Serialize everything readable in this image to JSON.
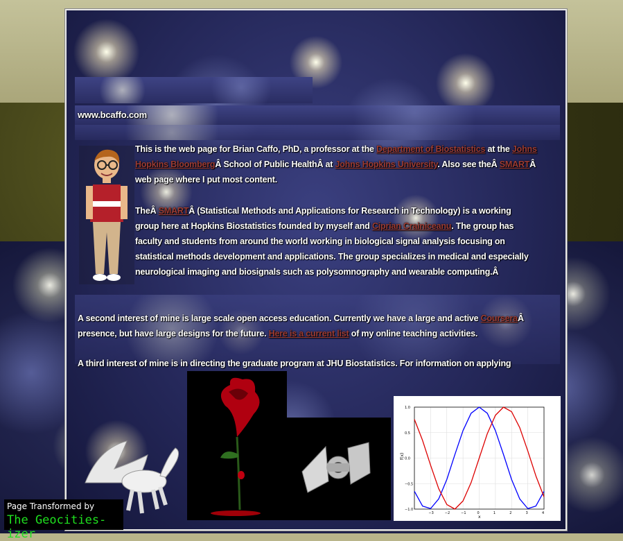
{
  "site": {
    "url_label": "www.bcaffo.com"
  },
  "para1": {
    "t1": "This is the web page for Brian Caffo, PhD, a professor at the ",
    "link_dept": "Department of Biostatistics",
    "t2": " at the ",
    "link_jh_bloomberg": "Johns Hopkins Bloomberg",
    "t3": "Â School of Public HealthÂ at ",
    "link_jhu": "Johns Hopkins University",
    "t4": ". Also see theÂ ",
    "link_smart": "SMART",
    "t5": "Â web page where I put most content."
  },
  "para2": {
    "t1": "TheÂ ",
    "link_smart": "SMART",
    "t2": "Â (Statistical Methods and Applications for Research in Technology) is a working group here at Hopkins Biostatistics founded by myself and ",
    "link_ciprian": "Ciprian Crainiceanu",
    "t3": ". The group has faculty and students from around the world working in biological signal analysis focusing on statistical methods development and applications. The group specializes in medical and especially neurological imaging and biosignals such as polysomnography and wearable computing.Â"
  },
  "para3": {
    "t1": "A second interest of mine is large scale open access education. Currently we have a large and active ",
    "link_coursera": "Coursera",
    "t2": "Â presence, but have large designs for the future. ",
    "link_current_list": "Here is a current list",
    "t3": " of my online teaching activities."
  },
  "para4": {
    "t1": "A third interest of mine is in directing the graduate program at JHU Biostatistics. For information on applying"
  },
  "badge": {
    "line1": "Page Transformed by",
    "line2": "The Geocities-izer"
  },
  "colors": {
    "link": "#9b3b33",
    "text": "#ffffff",
    "badge_green": "#1fe01f"
  },
  "chart_data": {
    "type": "line",
    "title": "",
    "xlabel": "x",
    "ylabel": "f(x)",
    "xlim": [
      -4,
      4
    ],
    "ylim": [
      -1.0,
      1.0
    ],
    "xticks": [
      "−3",
      "−2",
      "−1",
      "0",
      "1",
      "2",
      "3",
      "4"
    ],
    "yticks": [
      "1.0",
      "0.5",
      "0.0",
      "−0.5",
      "−1.0"
    ],
    "grid": true,
    "series": [
      {
        "color": "#0000ff",
        "x": [
          -4,
          -3.5,
          -3,
          -2.5,
          -2,
          -1.5,
          -1,
          -0.5,
          0,
          0.5,
          1,
          1.5,
          2,
          2.5,
          3,
          3.5,
          4
        ],
        "y": [
          -0.65,
          -0.94,
          -0.99,
          -0.8,
          -0.42,
          0.07,
          0.54,
          0.88,
          1.0,
          0.88,
          0.54,
          0.07,
          -0.42,
          -0.8,
          -0.99,
          -0.94,
          -0.65
        ]
      },
      {
        "color": "#dd0000",
        "x": [
          -4,
          -3.5,
          -3,
          -2.5,
          -2,
          -1.5,
          -1,
          -0.5,
          0,
          0.5,
          1,
          1.5,
          2,
          2.5,
          3,
          3.5,
          4
        ],
        "y": [
          0.76,
          0.35,
          -0.14,
          -0.6,
          -0.91,
          -1.0,
          -0.84,
          -0.48,
          0.0,
          0.48,
          0.84,
          1.0,
          0.91,
          0.6,
          0.14,
          -0.35,
          -0.76
        ]
      }
    ]
  }
}
